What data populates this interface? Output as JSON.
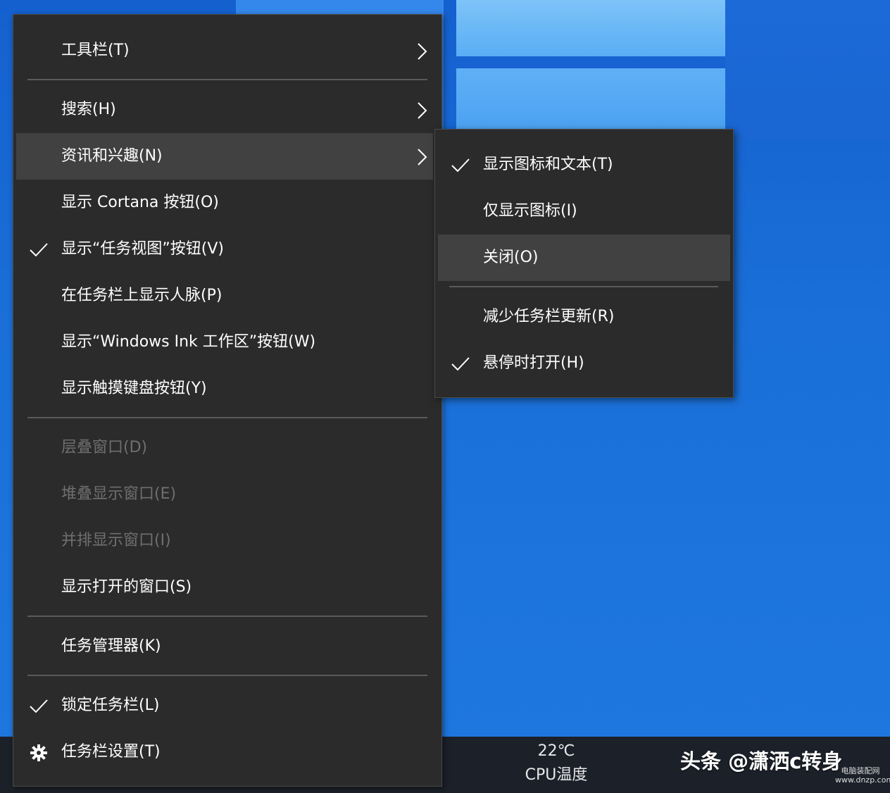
{
  "context_menu": {
    "items": [
      {
        "label": "工具栏(T)"
      },
      {
        "label": "搜索(H)"
      },
      {
        "label": "资讯和兴趣(N)"
      },
      {
        "label": "显示 Cortana 按钮(O)"
      },
      {
        "label": "显示“任务视图”按钮(V)"
      },
      {
        "label": "在任务栏上显示人脉(P)"
      },
      {
        "label": "显示“Windows Ink 工作区”按钮(W)"
      },
      {
        "label": "显示触摸键盘按钮(Y)"
      },
      {
        "label": "层叠窗口(D)"
      },
      {
        "label": "堆叠显示窗口(E)"
      },
      {
        "label": "并排显示窗口(I)"
      },
      {
        "label": "显示打开的窗口(S)"
      },
      {
        "label": "任务管理器(K)"
      },
      {
        "label": "锁定任务栏(L)"
      },
      {
        "label": "任务栏设置(T)"
      }
    ]
  },
  "submenu": {
    "items": [
      {
        "label": "显示图标和文本(T)"
      },
      {
        "label": "仅显示图标(I)"
      },
      {
        "label": "关闭(O)"
      },
      {
        "label": "减少任务栏更新(R)"
      },
      {
        "label": "悬停时打开(H)"
      }
    ]
  },
  "taskbar": {
    "temperature": "22℃",
    "temperature_label": "CPU温度"
  },
  "watermark": {
    "text": "头条 @潇洒c转身",
    "site_name": "电脑装配网",
    "site_url": "www.dnzp.com"
  },
  "colors": {
    "menu_bg": "#2b2b2b",
    "hover_bg": "#414141",
    "disabled_text": "#6f6f6f",
    "desktop_blue": "#1a6fd8"
  }
}
